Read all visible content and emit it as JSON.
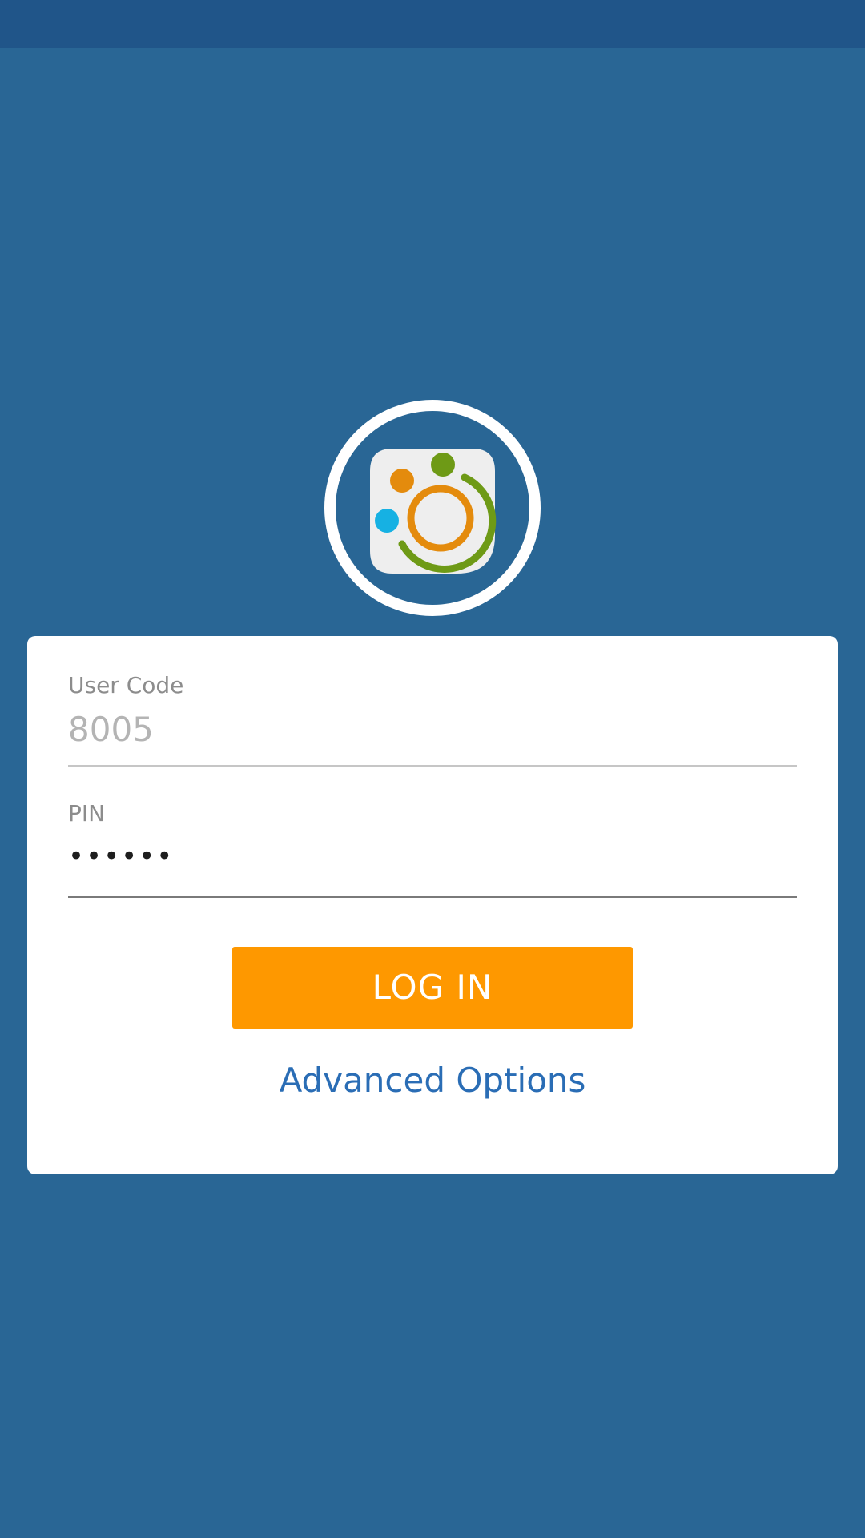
{
  "colors": {
    "background": "#296695",
    "status_bar": "#205589",
    "card": "#ffffff",
    "accent_button": "#fe9800",
    "link": "#2a6db5"
  },
  "logo": {
    "icon": "app-logo-icon"
  },
  "login_form": {
    "user_code": {
      "label": "User Code",
      "placeholder": "8005"
    },
    "pin": {
      "label": "PIN",
      "value": "••••••"
    },
    "login_button_label": "LOG IN",
    "advanced_options_label": "Advanced Options"
  }
}
